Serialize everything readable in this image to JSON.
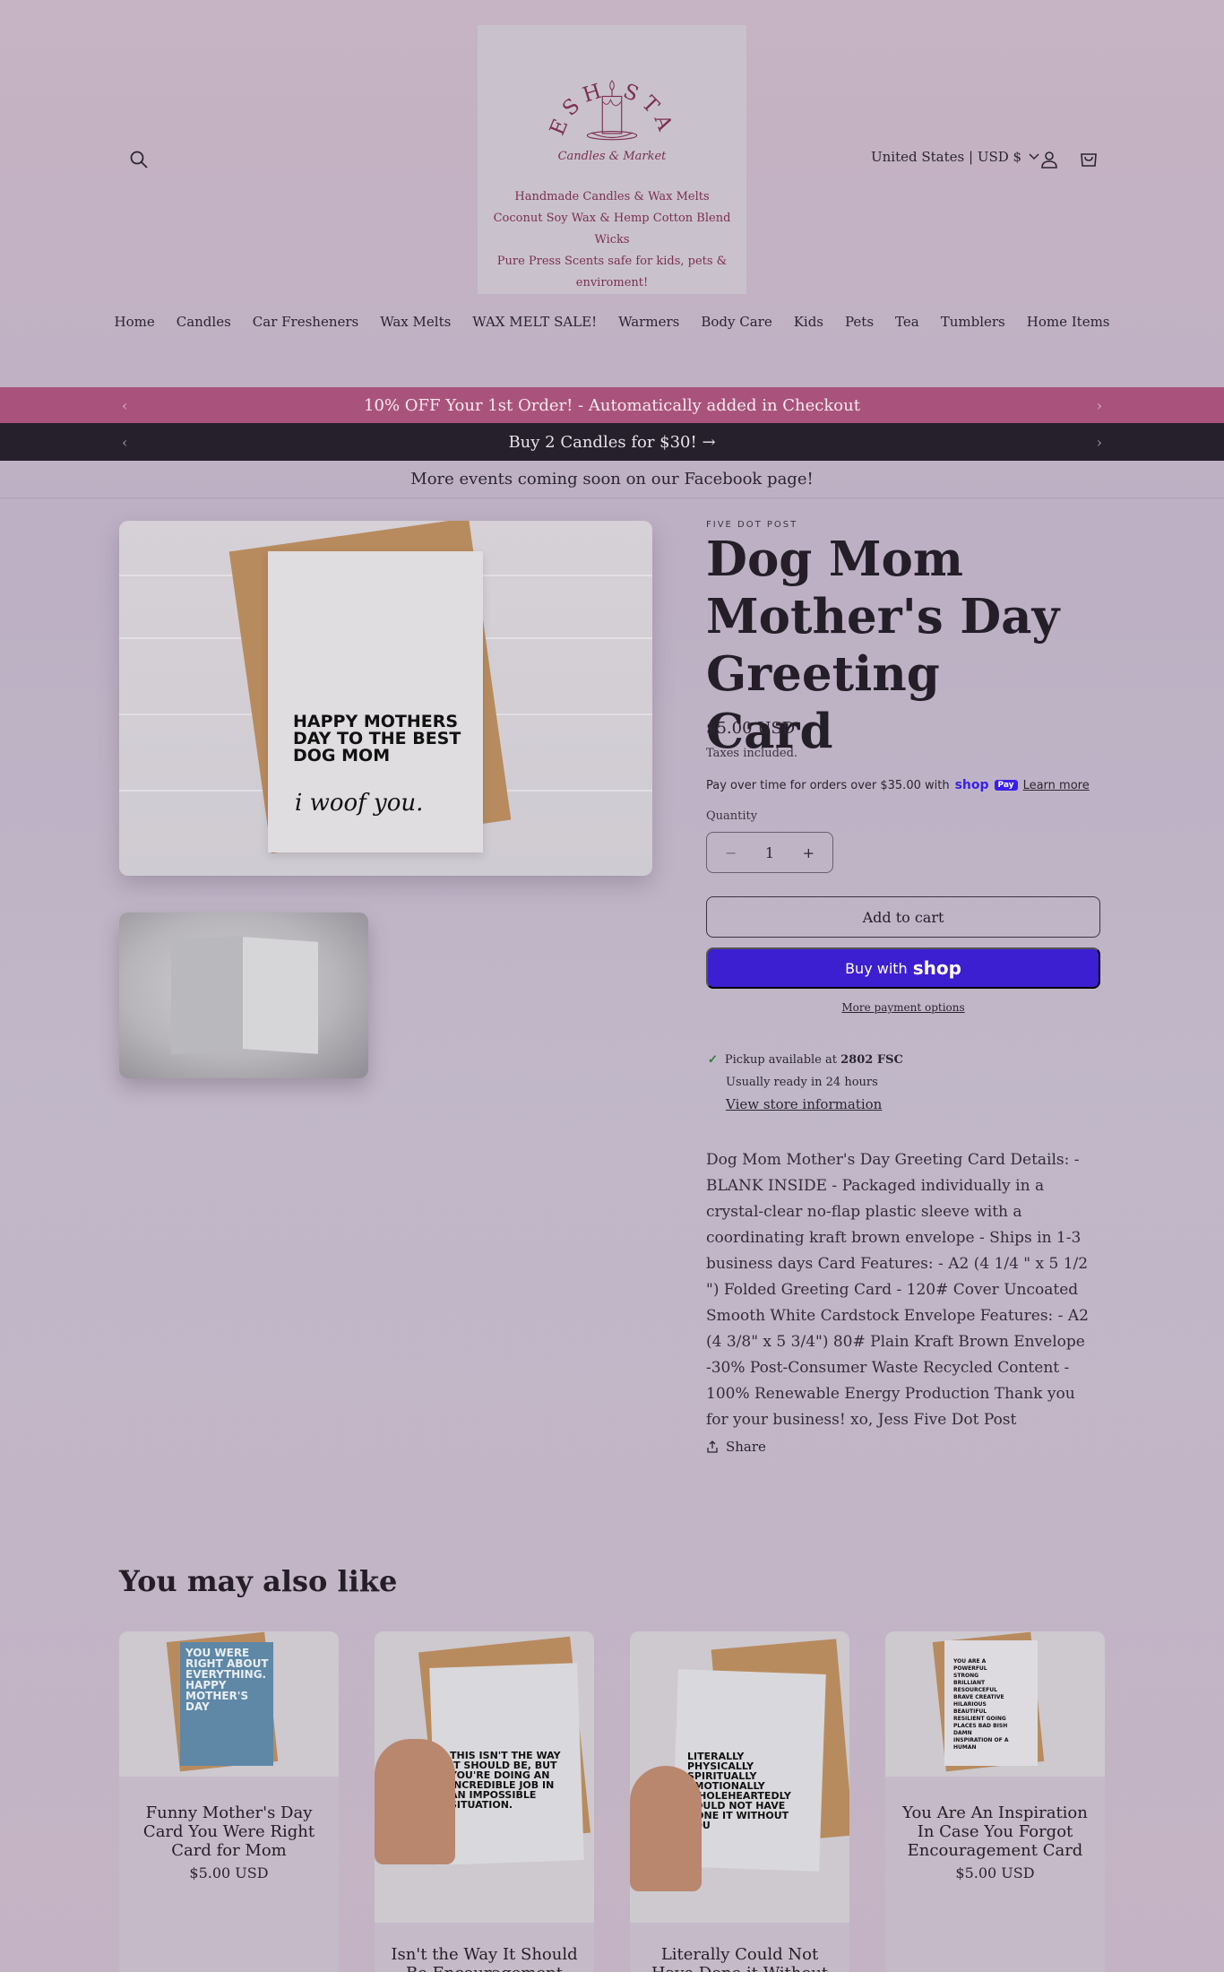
{
  "header": {
    "logo": {
      "brand": "FRESH START",
      "tagline": "Candles & Market",
      "lines": [
        "Handmade Candles & Wax Melts",
        "Coconut Soy Wax & Hemp Cotton Blend Wicks",
        "Pure Press Scents safe for kids, pets & enviroment!"
      ]
    },
    "country": "United States | USD $",
    "icons": {
      "search": "search-icon",
      "account": "account-icon",
      "cart": "cart-icon"
    }
  },
  "nav": [
    "Home",
    "Candles",
    "Car Fresheners",
    "Wax Melts",
    "WAX MELT SALE!",
    "Warmers",
    "Body Care",
    "Kids",
    "Pets",
    "Tea",
    "Tumblers",
    "Home Items"
  ],
  "announcements": {
    "promo": "10% OFF Your 1st Order! - Automatically added in Checkout",
    "deal": "Buy 2 Candles for $30! →",
    "events": "More events coming soon on our Facebook page!"
  },
  "gallery": {
    "card_text": "HAPPY MOTHERS DAY TO THE BEST DOG MOM",
    "card_script": "i woof you."
  },
  "product": {
    "vendor": "FIVE DOT POST",
    "title": "Dog Mom Mother's Day Greeting Card",
    "price": "$5.00 USD",
    "tax_note": "Taxes included.",
    "shop_pay": {
      "text": "Pay over time for orders over $35.00 with",
      "logo": "shop",
      "badge": "Pay",
      "link": "Learn more"
    },
    "quantity_label": "Quantity",
    "quantity": "1",
    "qty_minus": "−",
    "qty_plus": "+",
    "add_to_cart": "Add to cart",
    "buy_with": "Buy with",
    "buy_with_brand": "shop",
    "more_payment": "More payment options",
    "pickup": {
      "prefix": "Pickup available at",
      "location": "2802 FSC",
      "ready": "Usually ready in 24 hours",
      "link": "View store information"
    },
    "description": "Dog Mom Mother's Day Greeting Card Details: - BLANK INSIDE - Packaged individually in a crystal-clear no-flap plastic sleeve with a coordinating kraft brown envelope - Ships in 1-3 business days Card Features: - A2 (4 1/4 \" x 5 1/2 \") Folded Greeting Card - 120# Cover Uncoated Smooth White Cardstock Envelope Features: - A2 (4 3/8\" x 5 3/4\") 80# Plain Kraft Brown Envelope -30% Post-Consumer Waste Recycled Content - 100% Renewable Energy Production Thank you for your business! xo, Jess Five Dot Post",
    "share": "Share"
  },
  "recommendations": {
    "heading": "You may also like",
    "items": [
      {
        "name": "Funny Mother's Day Card You Were Right Card for Mom",
        "price": "$5.00 USD",
        "card_text": "YOU WERE RIGHT ABOUT EVERYTHING. HAPPY MOTHER'S DAY"
      },
      {
        "name": "Isn't the Way It Should Be Encouragement",
        "price": "",
        "card_text": "THIS ISN'T THE WAY IT SHOULD BE, BUT YOU'RE DOING AN INCREDIBLE JOB IN AN IMPOSSIBLE SITUATION."
      },
      {
        "name": "Literally Could Not Have Done it Without",
        "price": "",
        "card_text": "LITERALLY PHYSICALLY SPIRITUALLY EMOTIONALLY WHOLEHEARTEDLY COULD NOT HAVE DONE IT WITHOUT YOU"
      },
      {
        "name": "You Are An Inspiration In Case You Forgot Encouragement Card",
        "price": "$5.00 USD",
        "card_text": "YOU ARE A POWERFUL STRONG BRILLIANT RESOURCEFUL BRAVE CREATIVE HILARIOUS BEAUTIFUL RESILIENT GOING PLACES BAD BISH DAMN INSPIRATION OF A HUMAN"
      }
    ]
  },
  "colors": {
    "promo_bar": "#a9537c",
    "deal_bar": "#25202b",
    "shop_pay": "#3b1fd1",
    "logo_text": "#7c2e55"
  }
}
